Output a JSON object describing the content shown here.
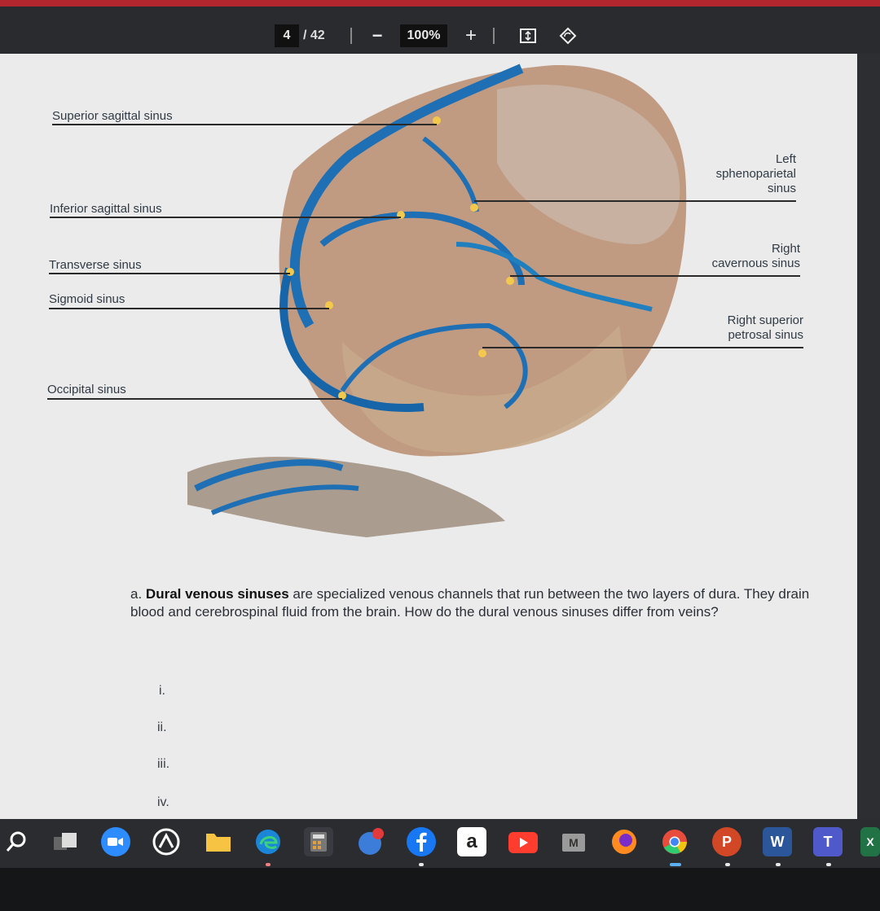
{
  "toolbar": {
    "page_current": "4",
    "page_total": "/ 42",
    "zoom_out": "−",
    "zoom": "100%",
    "zoom_in": "+"
  },
  "figure_labels": {
    "superior_sagittal": "Superior sagittal sinus",
    "inferior_sagittal": "Inferior sagittal sinus",
    "transverse": "Transverse sinus",
    "sigmoid": "Sigmoid sinus",
    "occipital": "Occipital sinus",
    "left_spheno_1": "Left",
    "left_spheno_2": "sphenoparietal",
    "left_spheno_3": "sinus",
    "right_cav_1": "Right",
    "right_cav_2": "cavernous sinus",
    "right_sup_1": "Right superior",
    "right_sup_2": "petrosal sinus"
  },
  "question": {
    "prefix": "a.",
    "bold": "Dural venous sinuses",
    "rest": " are specialized venous channels that run between the two layers of dura. They drain blood and cerebrospinal fluid from the brain. How do the dural venous sinuses differ from veins?",
    "items": [
      "i.",
      "ii.",
      "iii.",
      "iv."
    ]
  },
  "taskbar": {
    "icons": [
      "search-icon",
      "task-view-icon",
      "zoom-icon",
      "app-icon",
      "file-explorer-icon",
      "edge-icon",
      "calculator-icon",
      "app-icon",
      "facebook-icon",
      "amazon-icon",
      "youtube-icon",
      "gmail-icon",
      "firefox-icon",
      "chrome-icon",
      "powerpoint-icon",
      "word-icon",
      "teams-icon",
      "excel-icon"
    ],
    "amazon_letter": "a",
    "gmail_letter": "M",
    "powerpoint_letter": "P",
    "word_letter": "W",
    "teams_letter": "T",
    "excel_letter": "X"
  }
}
